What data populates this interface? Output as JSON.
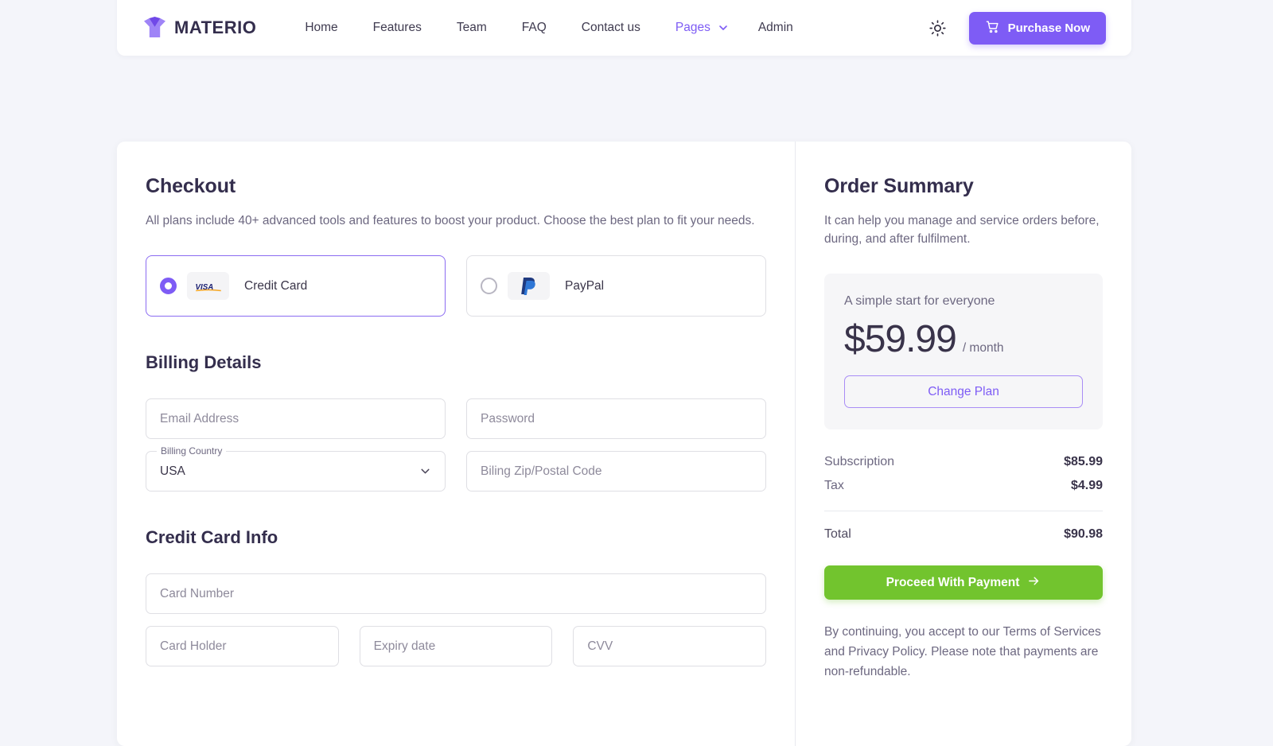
{
  "navbar": {
    "brand": "MATERIO",
    "brand_icon": "materio-m-logo",
    "links": [
      {
        "label": "Home",
        "accent": false
      },
      {
        "label": "Features",
        "accent": false
      },
      {
        "label": "Team",
        "accent": false
      },
      {
        "label": "FAQ",
        "accent": false
      },
      {
        "label": "Contact us",
        "accent": false
      },
      {
        "label": "Pages",
        "accent": true
      },
      {
        "label": "Admin",
        "accent": false
      }
    ],
    "pages_chevron_icon": "chevron-down-icon",
    "theme_toggle_icon": "sun-icon",
    "purchase_label": "Purchase Now",
    "purchase_icon": "shopping-cart-icon",
    "accent_color": "#7E5CF5"
  },
  "checkout": {
    "title": "Checkout",
    "subtitle": "All plans include 40+ advanced tools and features to boost your product. Choose the best plan to fit your needs.",
    "payment_methods": [
      {
        "label": "Credit Card",
        "icon": "visa-logo",
        "selected": true
      },
      {
        "label": "PayPal",
        "icon": "paypal-logo",
        "selected": false
      }
    ],
    "billing_title": "Billing Details",
    "billing_fields": {
      "email_placeholder": "Email Address",
      "password_placeholder": "Password",
      "country_label": "Billing Country",
      "country_value": "USA",
      "zip_placeholder": "Biling Zip/Postal Code"
    },
    "card_title": "Credit Card Info",
    "card_fields": {
      "card_number_placeholder": "Card Number",
      "card_holder_placeholder": "Card Holder",
      "expiry_placeholder": "Expiry date",
      "cvv_placeholder": "CVV"
    }
  },
  "summary": {
    "title": "Order Summary",
    "subtitle": "It can help you manage and service orders before, during, and after fulfilment.",
    "plan_name": "A simple start for everyone",
    "price_amount": "$59.99",
    "price_period": "/ month",
    "change_plan_label": "Change Plan",
    "lines": [
      {
        "label": "Subscription",
        "amount": "$85.99"
      },
      {
        "label": "Tax",
        "amount": "$4.99"
      }
    ],
    "total_label": "Total",
    "total_amount": "$90.98",
    "proceed_label": "Proceed With Payment",
    "proceed_icon": "arrow-right-icon",
    "proceed_color": "#72C42E",
    "fine_print": "By continuing, you accept to our Terms of Services and Privacy Policy. Please note that payments are non-refundable."
  }
}
